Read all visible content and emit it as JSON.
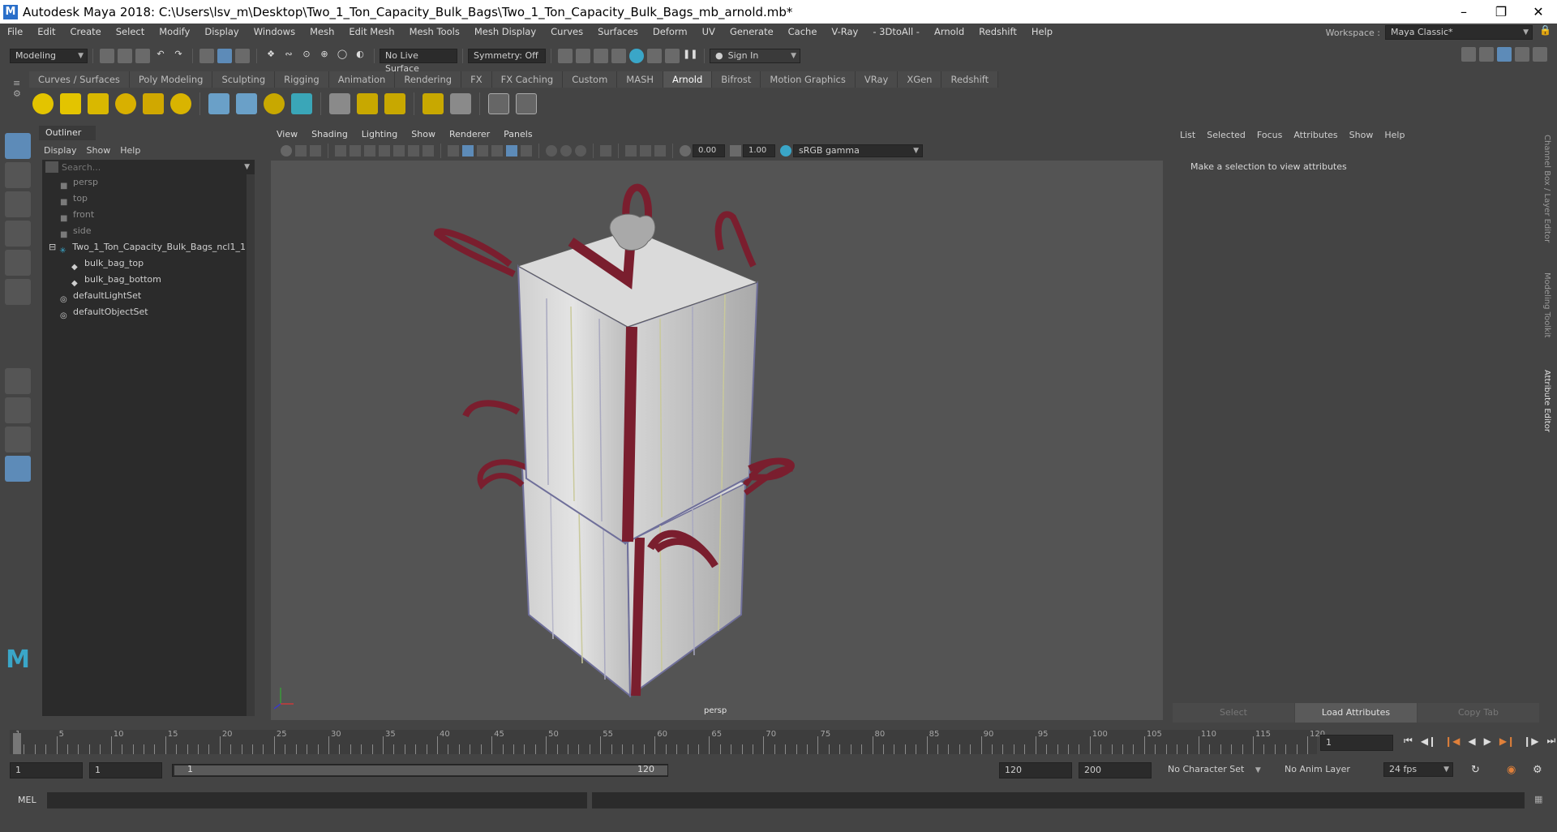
{
  "titlebar": {
    "title": "Autodesk Maya 2018: C:\\Users\\lsv_m\\Desktop\\Two_1_Ton_Capacity_Bulk_Bags\\Two_1_Ton_Capacity_Bulk_Bags_mb_arnold.mb*",
    "app_logo": "M"
  },
  "menubar": {
    "items": [
      "File",
      "Edit",
      "Create",
      "Select",
      "Modify",
      "Display",
      "Windows",
      "Mesh",
      "Edit Mesh",
      "Mesh Tools",
      "Mesh Display",
      "Curves",
      "Surfaces",
      "Deform",
      "UV",
      "Generate",
      "Cache",
      "V-Ray",
      "- 3DtoAll -",
      "Arnold",
      "Redshift",
      "Help"
    ],
    "workspace_label": "Workspace :",
    "workspace_value": "Maya Classic*"
  },
  "statusline": {
    "mode": "Modeling",
    "live_surface": "No Live Surface",
    "symmetry": "Symmetry: Off",
    "sign_in": "Sign In"
  },
  "shelf": {
    "tabs": [
      "Curves / Surfaces",
      "Poly Modeling",
      "Sculpting",
      "Rigging",
      "Animation",
      "Rendering",
      "FX",
      "FX Caching",
      "Custom",
      "MASH",
      "Arnold",
      "Bifrost",
      "Motion Graphics",
      "VRay",
      "XGen",
      "Redshift"
    ],
    "active_tab": "Arnold"
  },
  "outliner": {
    "title": "Outliner",
    "menu": [
      "Display",
      "Show",
      "Help"
    ],
    "search_placeholder": "Search...",
    "items": [
      {
        "label": "persp",
        "dim": true,
        "indent": 1,
        "icon": "camera-icon"
      },
      {
        "label": "top",
        "dim": true,
        "indent": 1,
        "icon": "camera-icon"
      },
      {
        "label": "front",
        "dim": true,
        "indent": 1,
        "icon": "camera-icon"
      },
      {
        "label": "side",
        "dim": true,
        "indent": 1,
        "icon": "camera-icon"
      },
      {
        "label": "Two_1_Ton_Capacity_Bulk_Bags_ncl1_1",
        "dim": false,
        "indent": 0,
        "icon": "group-icon"
      },
      {
        "label": "bulk_bag_top",
        "dim": false,
        "indent": 2,
        "icon": "mesh-icon"
      },
      {
        "label": "bulk_bag_bottom",
        "dim": false,
        "indent": 2,
        "icon": "mesh-icon"
      },
      {
        "label": "defaultLightSet",
        "dim": false,
        "indent": 1,
        "icon": "set-icon"
      },
      {
        "label": "defaultObjectSet",
        "dim": false,
        "indent": 1,
        "icon": "set-icon"
      }
    ]
  },
  "viewport": {
    "menu": [
      "View",
      "Shading",
      "Lighting",
      "Show",
      "Renderer",
      "Panels"
    ],
    "exposure": "0.00",
    "gamma": "1.00",
    "color_space": "sRGB gamma",
    "camera_label": "persp"
  },
  "attribute_editor": {
    "menu": [
      "List",
      "Selected",
      "Focus",
      "Attributes",
      "Show",
      "Help"
    ],
    "message": "Make a selection to view attributes",
    "buttons": {
      "select": "Select",
      "load": "Load Attributes",
      "copy": "Copy Tab"
    },
    "side_tabs": [
      "Channel Box / Layer Editor",
      "Modeling Toolkit",
      "Attribute Editor"
    ]
  },
  "timeline": {
    "ticks": [
      "1",
      "5",
      "10",
      "15",
      "20",
      "25",
      "30",
      "35",
      "40",
      "45",
      "50",
      "55",
      "60",
      "65",
      "70",
      "75",
      "80",
      "85",
      "90",
      "95",
      "100",
      "105",
      "110",
      "115",
      "120"
    ],
    "current_frame": "1"
  },
  "range": {
    "start": "1",
    "anim_start": "1",
    "range_start": "1",
    "range_end": "120",
    "anim_end_field": "120",
    "end": "200",
    "character_set": "No Character Set",
    "anim_layer": "No Anim Layer",
    "fps": "24 fps"
  },
  "cmdline": {
    "label": "MEL"
  },
  "colors": {
    "accent": "#5d8bb8",
    "strap": "#7a1e2e"
  }
}
